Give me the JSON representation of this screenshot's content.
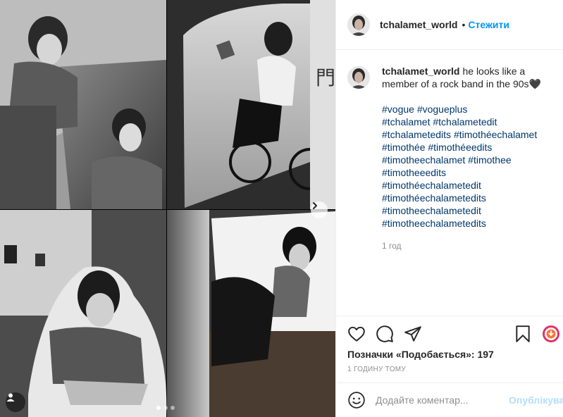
{
  "post": {
    "username": "tchalamet_world",
    "separator": "•",
    "follow_label": "Стежити",
    "caption_text": "he looks like a member of a rock band in the 90s🖤",
    "hashtags": [
      "#vogue #vogueplus",
      "#tchalamet #tchalametedit",
      "#tchalametedits #timothéechalamet",
      "#timothée #timothéeedits",
      "#timotheechalamet #timothee",
      "#timotheeedits",
      "#timothéechalametedit",
      "#timothéechalametedits",
      "#timotheechalametedit",
      "#timotheechalametedits"
    ],
    "caption_time": "1 год",
    "likes_label": "Позначки «Подобається»: 197",
    "posted_time": "1 годину тому"
  },
  "comment": {
    "placeholder": "Додайте коментар...",
    "post_label": "Опублікувати"
  },
  "icons": {
    "like": "heart-icon",
    "comment": "comment-icon",
    "share": "paper-plane-icon",
    "save": "bookmark-icon",
    "emoji": "smiley-icon",
    "next": "chevron-right-icon",
    "user_tags": "user-icon"
  },
  "carousel": {
    "count": 3,
    "active": 0
  },
  "colors": {
    "follow": "#0095f6",
    "hashtag": "#00376b",
    "post_disabled": "#b2dffc",
    "muted": "#8e8e8e"
  }
}
